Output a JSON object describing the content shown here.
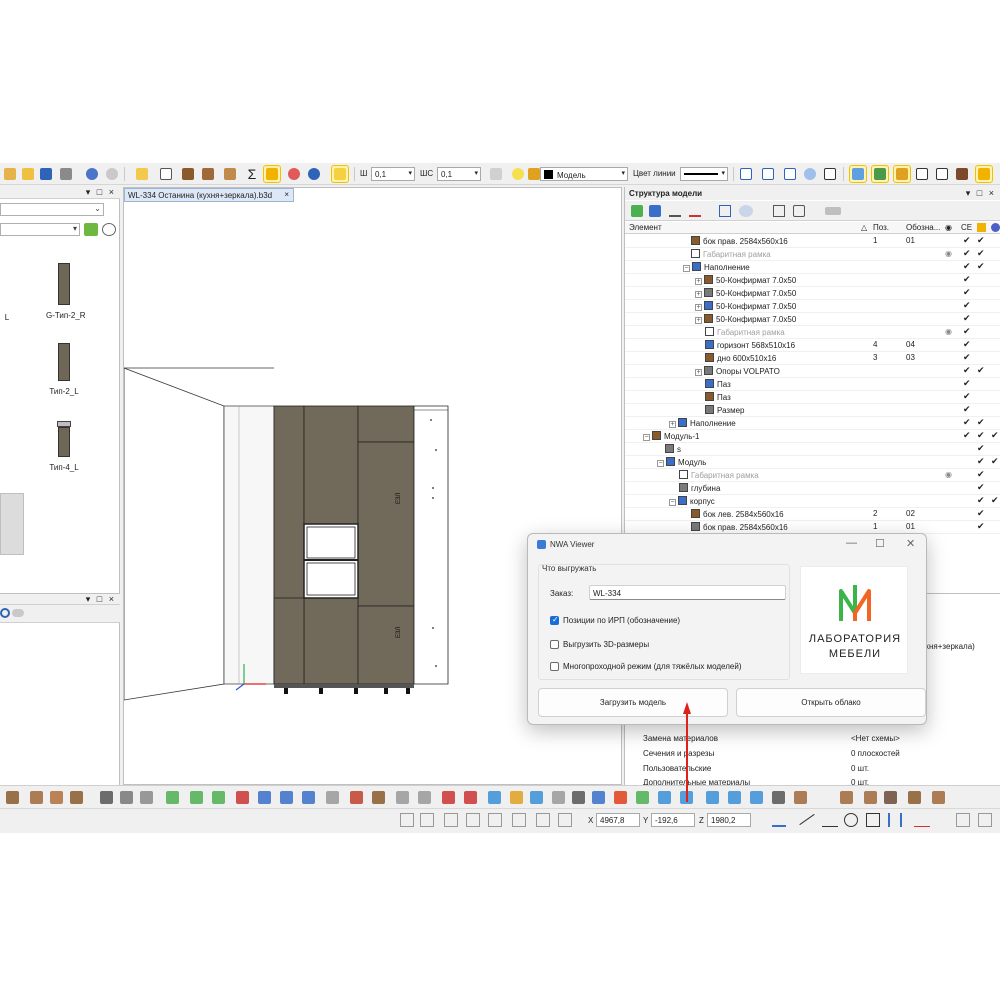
{
  "toolbar": {
    "sh_label": "Ш",
    "sh_value": "0,1",
    "shs_label": "ШС",
    "shs_value": "0,1",
    "layer_value": "Модель",
    "line_color_label": "Цвет линии"
  },
  "left_panel": {
    "thumbs": [
      {
        "label": "G-Тип-2_R"
      },
      {
        "label": "Тип-2_L"
      },
      {
        "label": "Тип-4_L"
      }
    ],
    "partial_label": "L"
  },
  "viewport": {
    "tab_label": "WL-334 Останина (кухня+зеркала).b3d",
    "tab_close": "×"
  },
  "structure": {
    "title": "Структура модели",
    "col_element": "Элемент",
    "col_pos": "Поз.",
    "col_des": "Обозна...",
    "col_ce": "CE",
    "rows": [
      {
        "indent": 66,
        "name": "бок прав. 2584x560x16",
        "pos": "1",
        "des": "01",
        "eye": "",
        "ce": "✔",
        "c3": "✔",
        "c4": "",
        "gray": false,
        "pm": ""
      },
      {
        "indent": 66,
        "name": "Габаритная рамка",
        "pos": "",
        "des": "",
        "eye": "◉",
        "ce": "✔",
        "c3": "✔",
        "c4": "",
        "gray": true,
        "pm": ""
      },
      {
        "indent": 58,
        "name": "Наполнение",
        "pos": "",
        "des": "",
        "eye": "",
        "ce": "✔",
        "c3": "✔",
        "c4": "",
        "gray": false,
        "pm": "−"
      },
      {
        "indent": 70,
        "name": "50-Конфирмат 7.0x50",
        "pos": "",
        "des": "",
        "eye": "",
        "ce": "✔",
        "c3": "",
        "c4": "",
        "gray": false,
        "pm": "+"
      },
      {
        "indent": 70,
        "name": "50-Конфирмат 7.0x50",
        "pos": "",
        "des": "",
        "eye": "",
        "ce": "✔",
        "c3": "",
        "c4": "",
        "gray": false,
        "pm": "+"
      },
      {
        "indent": 70,
        "name": "50-Конфирмат 7.0x50",
        "pos": "",
        "des": "",
        "eye": "",
        "ce": "✔",
        "c3": "",
        "c4": "",
        "gray": false,
        "pm": "+"
      },
      {
        "indent": 70,
        "name": "50-Конфирмат 7.0x50",
        "pos": "",
        "des": "",
        "eye": "",
        "ce": "✔",
        "c3": "",
        "c4": "",
        "gray": false,
        "pm": "+"
      },
      {
        "indent": 80,
        "name": "Габаритная рамка",
        "pos": "",
        "des": "",
        "eye": "◉",
        "ce": "✔",
        "c3": "",
        "c4": "",
        "gray": true,
        "pm": ""
      },
      {
        "indent": 80,
        "name": "горизонт 568x510x16",
        "pos": "4",
        "des": "04",
        "eye": "",
        "ce": "✔",
        "c3": "",
        "c4": "",
        "gray": false,
        "pm": ""
      },
      {
        "indent": 80,
        "name": "дно 600x510x16",
        "pos": "3",
        "des": "03",
        "eye": "",
        "ce": "✔",
        "c3": "",
        "c4": "",
        "gray": false,
        "pm": ""
      },
      {
        "indent": 70,
        "name": "Опоры VOLPATO",
        "pos": "",
        "des": "",
        "eye": "",
        "ce": "✔",
        "c3": "✔",
        "c4": "",
        "gray": false,
        "pm": "+"
      },
      {
        "indent": 80,
        "name": "Паз",
        "pos": "",
        "des": "",
        "eye": "",
        "ce": "✔",
        "c3": "",
        "c4": "",
        "gray": false,
        "pm": ""
      },
      {
        "indent": 80,
        "name": "Паз",
        "pos": "",
        "des": "",
        "eye": "",
        "ce": "✔",
        "c3": "",
        "c4": "",
        "gray": false,
        "pm": ""
      },
      {
        "indent": 80,
        "name": "Размер",
        "pos": "",
        "des": "",
        "eye": "",
        "ce": "✔",
        "c3": "",
        "c4": "",
        "gray": false,
        "pm": ""
      },
      {
        "indent": 44,
        "name": "Наполнение",
        "pos": "",
        "des": "",
        "eye": "",
        "ce": "✔",
        "c3": "✔",
        "c4": "",
        "gray": false,
        "pm": "+"
      },
      {
        "indent": 18,
        "name": "Модуль-1",
        "pos": "",
        "des": "",
        "eye": "",
        "ce": "✔",
        "c3": "✔",
        "c4": "✔",
        "gray": false,
        "pm": "−"
      },
      {
        "indent": 40,
        "name": "s",
        "pos": "",
        "des": "",
        "eye": "",
        "ce": "",
        "c3": "✔",
        "c4": "",
        "gray": false,
        "pm": ""
      },
      {
        "indent": 32,
        "name": "Модуль",
        "pos": "",
        "des": "",
        "eye": "",
        "ce": "",
        "c3": "✔",
        "c4": "✔",
        "gray": false,
        "pm": "−"
      },
      {
        "indent": 54,
        "name": "Габаритная рамка",
        "pos": "",
        "des": "",
        "eye": "◉",
        "ce": "",
        "c3": "✔",
        "c4": "",
        "gray": true,
        "pm": ""
      },
      {
        "indent": 54,
        "name": "глубина",
        "pos": "",
        "des": "",
        "eye": "",
        "ce": "",
        "c3": "✔",
        "c4": "",
        "gray": false,
        "pm": ""
      },
      {
        "indent": 44,
        "name": "корпус",
        "pos": "",
        "des": "",
        "eye": "",
        "ce": "",
        "c3": "✔",
        "c4": "✔",
        "gray": false,
        "pm": "−"
      },
      {
        "indent": 66,
        "name": "бок лев. 2584x560x16",
        "pos": "2",
        "des": "02",
        "eye": "",
        "ce": "",
        "c3": "✔",
        "c4": "",
        "gray": false,
        "pm": ""
      },
      {
        "indent": 66,
        "name": "бок прав. 2584x560x16",
        "pos": "1",
        "des": "01",
        "eye": "",
        "ce": "",
        "c3": "✔",
        "c4": "",
        "gray": false,
        "pm": ""
      }
    ]
  },
  "properties": {
    "partial_value": "хня+зеркала)",
    "rows": [
      {
        "name": "Замена материалов",
        "value": "<Нет схемы>"
      },
      {
        "name": "Сечения и разрезы",
        "value": "0 плоскостей"
      },
      {
        "name": "Пользовательские",
        "value": "0 шт."
      },
      {
        "name": "Дополнительные материалы",
        "value": "0 шт."
      }
    ]
  },
  "coords": {
    "x_label": "X",
    "x_value": "4967,8",
    "y_label": "Y",
    "y_value": "-192,6",
    "z_label": "Z",
    "z_value": "1980,2"
  },
  "dialog": {
    "title": "NWA Viewer",
    "group_title": "Что выгружать",
    "order_label": "Заказ:",
    "order_value": "WL-334",
    "options": [
      {
        "label": "Позиции по ИРП (обозначение)",
        "checked": true
      },
      {
        "label": "Выгрузить 3D-размеры",
        "checked": false
      },
      {
        "label": "Многопроходной режим (для тяжёлых моделей)",
        "checked": false
      }
    ],
    "logo_line1": "ЛАБОРАТОРИЯ",
    "logo_line2": "МЕБЕЛИ",
    "btn_load": "Загрузить модель",
    "btn_cloud": "Открыть облако",
    "win_min": "—",
    "win_max": "☐",
    "win_close": "✕"
  },
  "colors": {
    "cabinet": "#716a5a",
    "accent_blue": "#1a6dd6",
    "logo_green": "#3bb54a",
    "logo_orange": "#f26522",
    "arrow_red": "#e0201b"
  }
}
